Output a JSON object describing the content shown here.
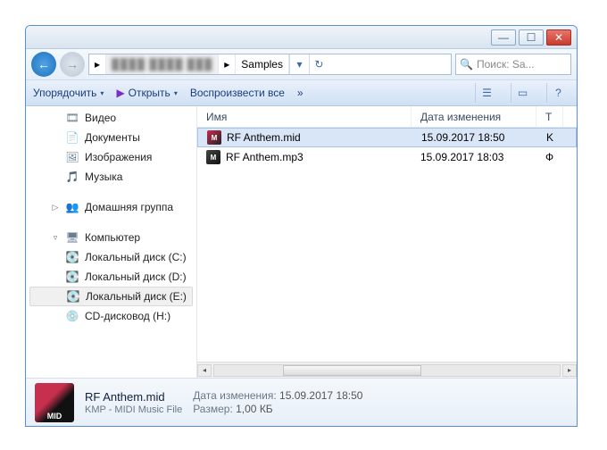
{
  "titlebar": {
    "min": "—",
    "max": "☐",
    "close": "✕"
  },
  "nav": {
    "back": "←",
    "fwd": "→"
  },
  "address": {
    "root": "▸",
    "blur": "████ ████ ███",
    "sep1": "▸",
    "folder": "Samples",
    "sep2": "▸",
    "drop": "▾",
    "refresh": "↻"
  },
  "search": {
    "placeholder": "Поиск: Sa...",
    "icon": "🔍"
  },
  "toolbar": {
    "organize": "Упорядочить",
    "organize_drop": "▾",
    "open": "Открыть",
    "open_drop": "▾",
    "play_icon": "▶",
    "playall": "Воспроизвести все",
    "more": "»",
    "view_icon": "☰",
    "preview_icon": "▭",
    "help_icon": "?"
  },
  "sidebar": {
    "video": "Видео",
    "documents": "Документы",
    "images": "Изображения",
    "music": "Музыка",
    "homegroup": "Домашняя группа",
    "computer": "Компьютер",
    "drive_c": "Локальный диск (C:)",
    "drive_d": "Локальный диск (D:)",
    "drive_e": "Локальный диск (E:)",
    "cd": "CD-дисковод (H:)"
  },
  "columns": {
    "name": "Имя",
    "date": "Дата изменения",
    "type": "Т"
  },
  "files": [
    {
      "name": "RF Anthem.mid",
      "date": "15.09.2017 18:50",
      "kind": "mid",
      "type_initial": "K",
      "selected": true
    },
    {
      "name": "RF Anthem.mp3",
      "date": "15.09.2017 18:03",
      "kind": "mp3",
      "type_initial": "Ф",
      "selected": false
    }
  ],
  "details": {
    "name": "RF Anthem.mid",
    "type": "KMP - MIDI Music File",
    "date_label": "Дата изменения:",
    "date": "15.09.2017 18:50",
    "size_label": "Размер:",
    "size": "1,00 КБ",
    "icon_text": "MID"
  }
}
